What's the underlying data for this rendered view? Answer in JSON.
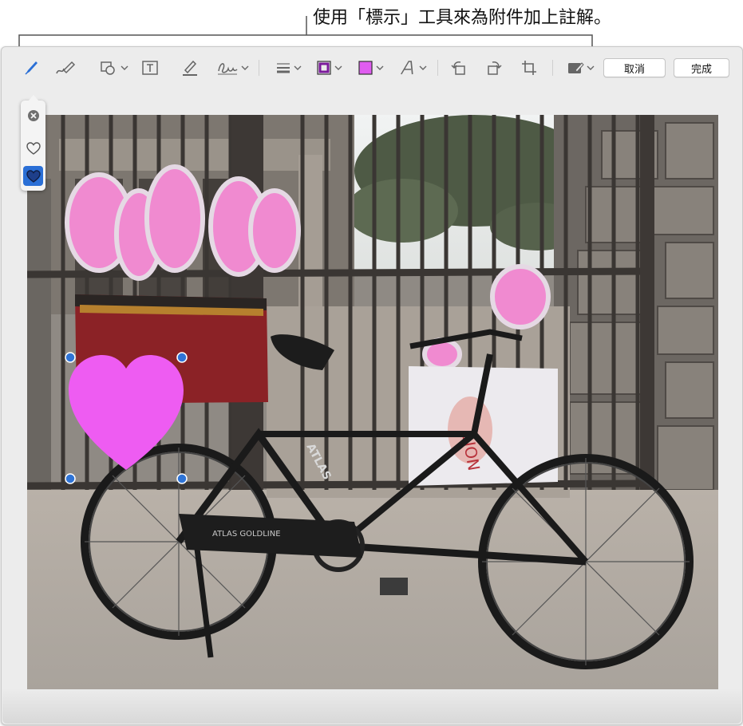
{
  "callout": {
    "text": "使用「標示」工具來為附件加上註解。"
  },
  "toolbar": {
    "tools": [
      {
        "icon": "sketch-pen-icon"
      },
      {
        "icon": "draw-brush-icon"
      },
      {
        "icon": "shapes-icon"
      },
      {
        "icon": "text-box-icon"
      },
      {
        "icon": "highlight-icon"
      },
      {
        "icon": "signature-icon"
      },
      {
        "icon": "line-style-icon"
      },
      {
        "icon": "border-color-icon"
      },
      {
        "icon": "fill-color-icon"
      },
      {
        "icon": "text-style-icon"
      },
      {
        "icon": "rotate-left-icon"
      },
      {
        "icon": "rotate-right-icon"
      },
      {
        "icon": "crop-icon"
      },
      {
        "icon": "annotate-form-icon"
      }
    ],
    "cancel_label": "取消",
    "done_label": "完成"
  },
  "colors": {
    "accent": "#2a6fd6",
    "border_color": "#7b1a9b",
    "fill_color": "#e05cf0",
    "heart_fill": "#ee5cf2",
    "handle": "#2f74d6"
  },
  "shapes_popover": {
    "items": [
      {
        "icon": "close-icon"
      },
      {
        "icon": "heart-outline-icon"
      },
      {
        "icon": "heart-filled-icon",
        "selected": true
      }
    ]
  },
  "photo": {
    "bike_logo": "ATLAS",
    "chainguard_text": "ATLAS GOLDLINE",
    "bag_text": "LION"
  }
}
